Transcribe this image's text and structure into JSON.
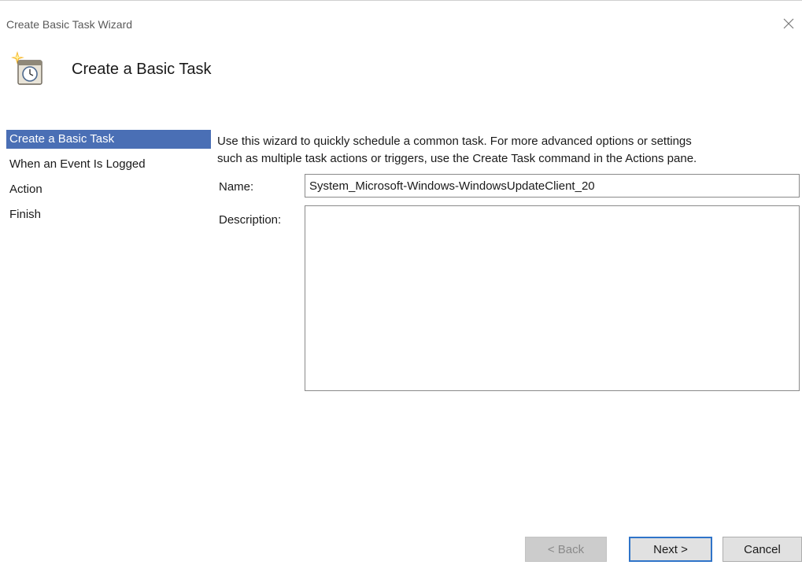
{
  "window": {
    "title": "Create Basic Task Wizard",
    "close_icon": "close-icon"
  },
  "header": {
    "icon": "clock-icon",
    "title": "Create a Basic Task"
  },
  "sidebar": {
    "items": [
      {
        "label": "Create a Basic Task",
        "active": true
      },
      {
        "label": "When an Event Is Logged",
        "active": false
      },
      {
        "label": "Action",
        "active": false
      },
      {
        "label": "Finish",
        "active": false
      }
    ]
  },
  "main": {
    "intro_line1": "Use this wizard to quickly schedule a common task.  For more advanced options or settings",
    "intro_line2": "such as multiple task actions or triggers, use the Create Task command in the Actions pane.",
    "name_label": "Name:",
    "name_value": "System_Microsoft-Windows-WindowsUpdateClient_20",
    "description_label": "Description:",
    "description_value": ""
  },
  "footer": {
    "back_label": "< Back",
    "next_label": "Next >",
    "cancel_label": "Cancel"
  },
  "colors": {
    "selected_item_bg": "#4a6fb5",
    "default_button_border": "#2f74c9",
    "disabled_button_bg": "#cccccc"
  }
}
